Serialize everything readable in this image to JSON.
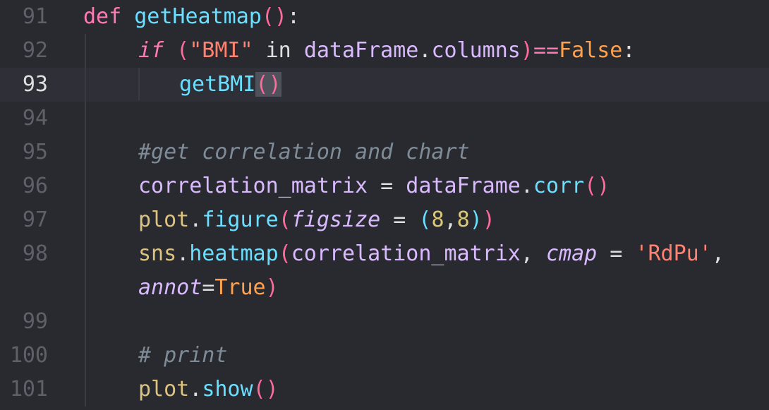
{
  "editor": {
    "lines": [
      {
        "num": "91",
        "tokens": [
          "def",
          " ",
          "getHeatmap",
          "()",
          ":"
        ]
      },
      {
        "num": "92",
        "tokens": [
          "if",
          " (",
          "\"BMI\"",
          " in ",
          "dataFrame",
          ".",
          "columns",
          ")",
          "==",
          "False",
          ":"
        ]
      },
      {
        "num": "93",
        "tokens": [
          "getBMI",
          "(",
          ")"
        ]
      },
      {
        "num": "94",
        "tokens": []
      },
      {
        "num": "95",
        "tokens": [
          "#get correlation and chart"
        ]
      },
      {
        "num": "96",
        "tokens": [
          "correlation_matrix",
          " = ",
          "dataFrame",
          ".",
          "corr",
          "()"
        ]
      },
      {
        "num": "97",
        "tokens": [
          "plot",
          ".",
          "figure",
          "(",
          "figsize",
          " = ",
          "(",
          "8",
          ",",
          "8",
          ")",
          ")"
        ]
      },
      {
        "num": "98",
        "tokens": [
          "sns",
          ".",
          "heatmap",
          "(",
          "correlation_matrix",
          ", ",
          "cmap",
          " = ",
          "'RdPu'",
          ","
        ]
      },
      {
        "num": "",
        "tokens": [
          "annot",
          "=",
          "True",
          ")"
        ]
      },
      {
        "num": "99",
        "tokens": []
      },
      {
        "num": "100",
        "tokens": [
          "# print"
        ]
      },
      {
        "num": "101",
        "tokens": [
          "plot",
          ".",
          "show",
          "()"
        ]
      }
    ],
    "current_line": "93",
    "colors": {
      "background": "#292a30",
      "current_line_bg": "#2f3037",
      "keyword": "#ff7ab2",
      "function": "#6bdfff",
      "identifier": "#dabaff",
      "string": "#ff8170",
      "number": "#d9c97c",
      "boolean": "#ffa14f",
      "comment": "#7f8c98",
      "line_number": "#5f6068"
    }
  }
}
